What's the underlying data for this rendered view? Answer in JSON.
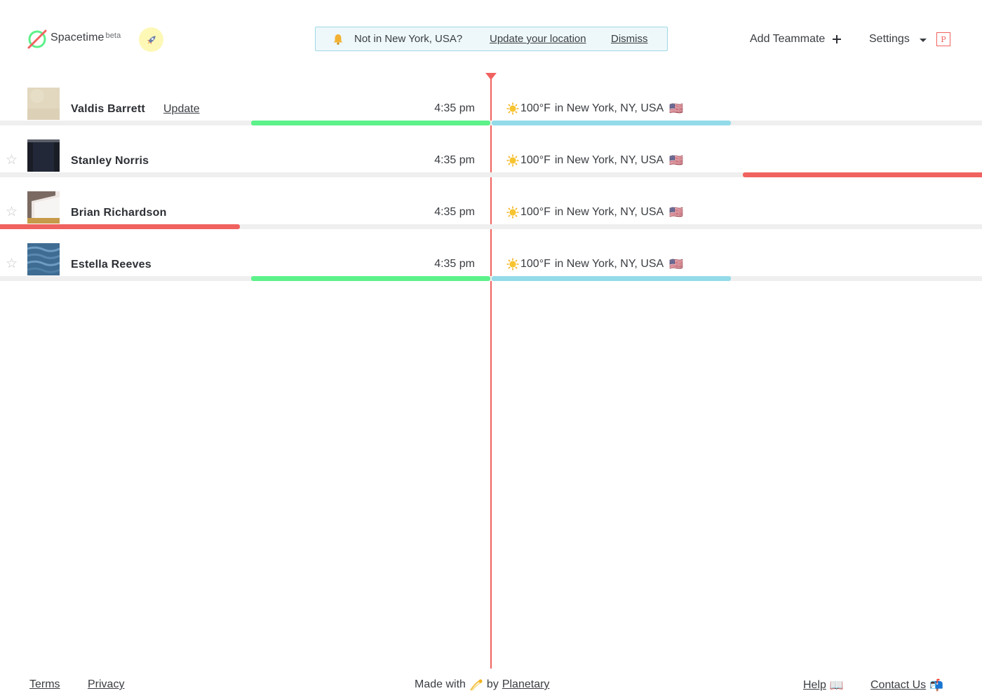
{
  "app": {
    "brand": "Spacetime",
    "brand_tag": "beta"
  },
  "header": {
    "notice": {
      "message": "Not in New York, USA?",
      "update_label": "Update your location",
      "dismiss_label": "Dismiss"
    },
    "add_teammate_label": "Add Teammate",
    "add_icon": "plus-icon",
    "settings_label": "Settings",
    "user_initial": "P"
  },
  "colors": {
    "accent": "#f0625f",
    "work_hours": "#5df18a",
    "evening": "#93dbe8",
    "notice_bg": "#eef8fb",
    "rocket_bg": "#fdf8b6"
  },
  "teammates": [
    {
      "name": "Valdis Barrett",
      "action_label": "Update",
      "time": "4:35 pm",
      "weather_icon": "sun-icon",
      "temperature": "100°F",
      "location": "in New York, NY, USA",
      "flag": "🇺🇸",
      "photo": "beige-texture"
    },
    {
      "name": "Stanley Norris",
      "time": "4:35 pm",
      "weather_icon": "sun-icon",
      "temperature": "100°F",
      "location": "in New York, NY, USA",
      "flag": "🇺🇸",
      "photo": "dark-figure"
    },
    {
      "name": "Brian Richardson",
      "time": "4:35 pm",
      "weather_icon": "sun-icon",
      "temperature": "100°F",
      "location": "in New York, NY, USA",
      "flag": "🇺🇸",
      "photo": "white-frame"
    },
    {
      "name": "Estella Reeves",
      "time": "4:35 pm",
      "weather_icon": "sun-icon",
      "temperature": "100°F",
      "location": "in New York, NY, USA",
      "flag": "🇺🇸",
      "photo": "ocean-water"
    }
  ],
  "footer": {
    "terms": "Terms",
    "privacy": "Privacy",
    "made_with": "Made with",
    "made_icon": "comet-emoji",
    "by": "by",
    "company": "Planetary",
    "help": "Help",
    "help_icon": "📖",
    "contact": "Contact Us",
    "contact_icon": "📬"
  }
}
